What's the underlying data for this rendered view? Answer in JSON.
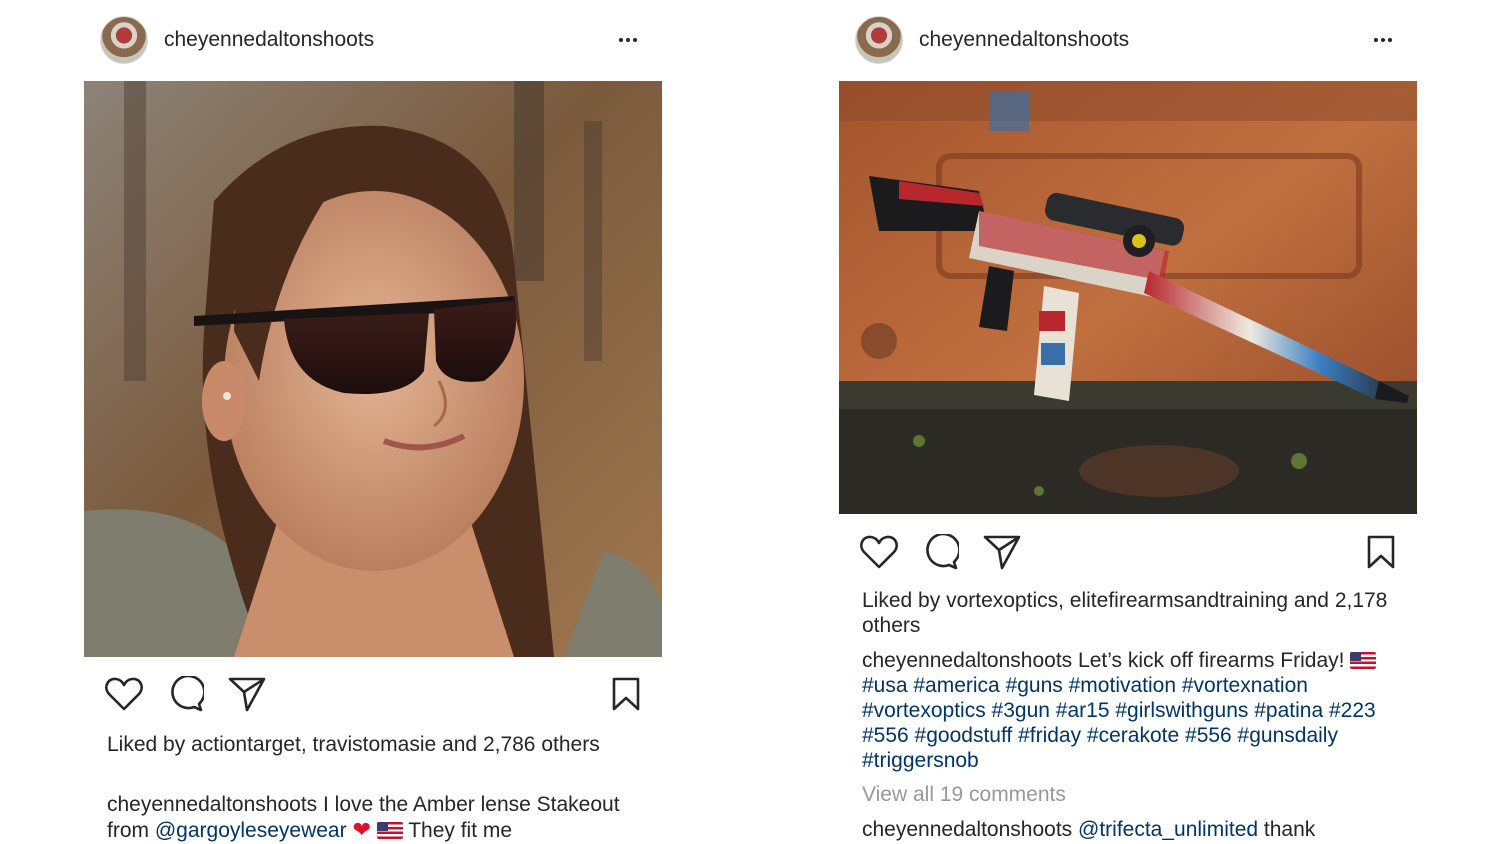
{
  "posts": [
    {
      "username": "cheyennedaltonshoots",
      "likes_prefix": "Liked by",
      "liked_by_1": "actiontarget",
      "liked_sep": ",",
      "liked_by_2": "travistomasie",
      "liked_and": "and",
      "liked_count": "2,786",
      "liked_suffix": "others",
      "caption_user": "cheyennedaltonshoots",
      "caption_text_1": "I love the Amber lense Stakeout from",
      "caption_mention": "@gargoyleseyewear",
      "caption_text_2": "They fit me"
    },
    {
      "username": "cheyennedaltonshoots",
      "likes_prefix": "Liked by",
      "liked_by_1": "vortexoptics",
      "liked_sep": ",",
      "liked_by_2": "elitefirearmsandtraining",
      "liked_and": "and",
      "liked_count": "2,178 others",
      "caption_user": "cheyennedaltonshoots",
      "caption_text": "Let’s kick off firearms Friday!",
      "hashtags": "#usa #america #guns #motivation #vortexnation #vortexoptics #3gun #ar15 #girlswithguns #patina #223 #556 #goodstuff #friday #cerakote #556 #gunsdaily #triggersnob",
      "view_comments": "View all 19 comments",
      "comment_user": "cheyennedaltonshoots",
      "comment_mention": "@trifecta_unlimited",
      "comment_text": "thank"
    }
  ],
  "icons": {
    "more": "more-options-icon",
    "like": "heart-icon",
    "comment": "comment-icon",
    "share": "share-icon",
    "save": "bookmark-icon"
  },
  "colors": {
    "text": "#262626",
    "link": "#003569",
    "muted": "#999999"
  }
}
